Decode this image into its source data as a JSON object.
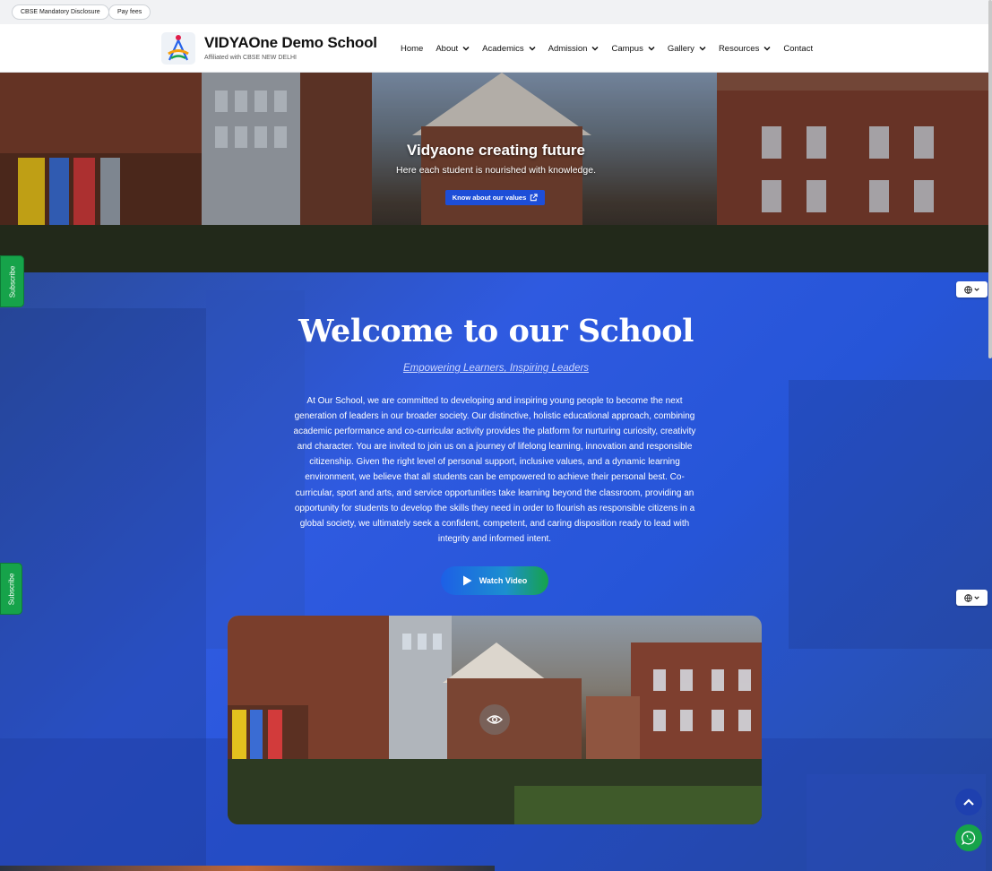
{
  "topbar": {
    "links": [
      "CBSE Mandatory Disclosure",
      "Pay fees"
    ]
  },
  "header": {
    "title": "VIDYAOne Demo School",
    "subtitle": "Affiliated with CBSE NEW DELHI",
    "nav": [
      {
        "label": "Home",
        "dropdown": false
      },
      {
        "label": "About",
        "dropdown": true
      },
      {
        "label": "Academics",
        "dropdown": true
      },
      {
        "label": "Admission",
        "dropdown": true
      },
      {
        "label": "Campus",
        "dropdown": true
      },
      {
        "label": "Gallery",
        "dropdown": true
      },
      {
        "label": "Resources",
        "dropdown": true
      },
      {
        "label": "Contact",
        "dropdown": false
      }
    ]
  },
  "hero": {
    "title": "Vidyaone creating future",
    "subtitle": "Here each student is nourished with knowledge.",
    "button_label": "Know about our values"
  },
  "welcome": {
    "title": "Welcome to our School",
    "tagline": "Empowering Learners, Inspiring Leaders",
    "body": "At Our School, we are committed to developing and inspiring young people to become the next generation of leaders in our broader society. Our distinctive, holistic educational approach, combining academic performance and co-curricular activity provides the platform for nurturing curiosity, creativity and character. You are invited to join us on a journey of lifelong learning, innovation and responsible citizenship. Given the right level of personal support, inclusive values, and a dynamic learning environment, we believe that all students can be empowered to achieve their personal best. Co-curricular, sport and arts, and service opportunities take learning beyond the classroom, providing an opportunity for students to develop the skills they need in order to flourish as responsible citizens in a global society, we ultimately seek a confident, competent, and caring disposition ready to lead with integrity and informed intent.",
    "video_button_label": "Watch Video"
  },
  "floating": {
    "subscribe_label": "Subscribe"
  },
  "icons": {
    "external_link": "external-link-icon",
    "play": "play-icon",
    "eye": "eye-icon",
    "globe": "globe-icon",
    "chevron_up": "chevron-up-icon",
    "whatsapp": "whatsapp-icon"
  },
  "colors": {
    "primary": "#1d4ed8",
    "accent_green": "#16a34a",
    "hero_overlay": "#2f5ae0",
    "scroll_top_btn": "#1e40af",
    "whatsapp": "#16a34a"
  }
}
